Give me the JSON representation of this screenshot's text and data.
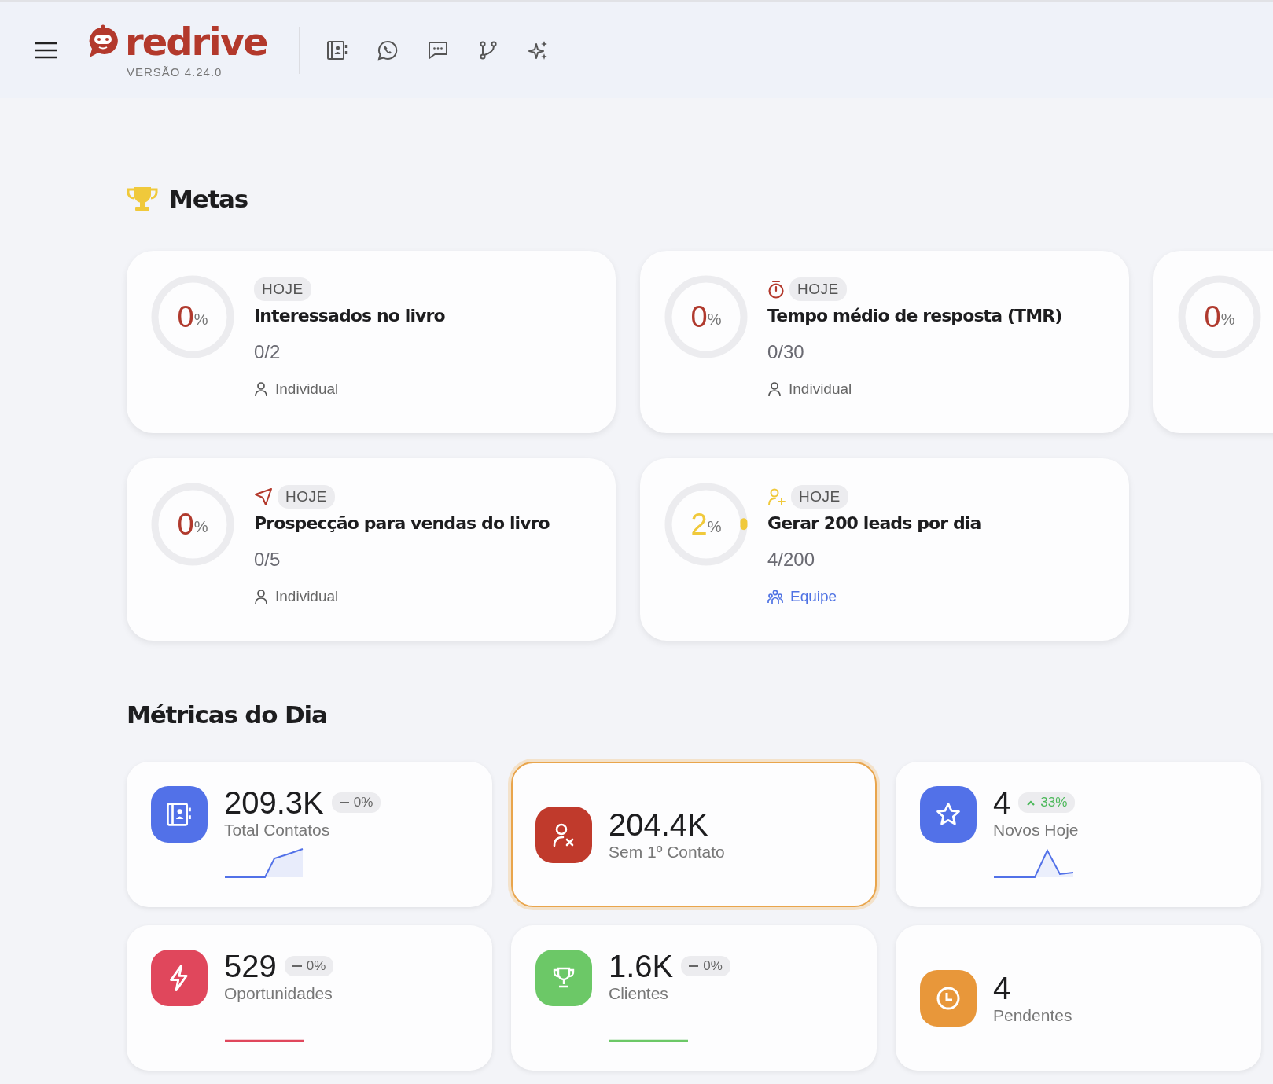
{
  "header": {
    "brand": "redrive",
    "version": "VERSÃO 4.24.0",
    "toolbar": [
      {
        "kind": "contacts"
      },
      {
        "kind": "whatsapp"
      },
      {
        "kind": "chat"
      },
      {
        "kind": "branch"
      },
      {
        "kind": "sparkle"
      }
    ]
  },
  "goals": {
    "title": "Metas",
    "items": [
      {
        "percent": "0",
        "unit": "%",
        "level": 0,
        "color": "#b03a2e",
        "badge": "HOJE",
        "title": "Interessados no livro",
        "progress": "0/2",
        "scope": {
          "kind": "individual",
          "label": "Individual"
        }
      },
      {
        "percent": "0",
        "unit": "%",
        "level": 0,
        "color": "#b03a2e",
        "kind": "timer",
        "badge": "HOJE",
        "title": "Tempo médio de resposta (TMR)",
        "progress": "0/30",
        "scope": {
          "kind": "individual",
          "label": "Individual"
        }
      },
      {
        "percent": "0",
        "unit": "%",
        "level": 0,
        "color": "#b03a2e"
      },
      {
        "percent": "0",
        "unit": "%",
        "level": 0,
        "color": "#b03a2e",
        "kind": "send",
        "badge": "HOJE",
        "title": "Prospecção para vendas do livro",
        "progress": "0/5",
        "scope": {
          "kind": "individual",
          "label": "Individual"
        }
      },
      {
        "percent": "2",
        "unit": "%",
        "level": 0.02,
        "color": "#f0c93b",
        "kind": "user-plus",
        "badge": "HOJE",
        "title": "Gerar 200 leads por dia",
        "progress": "4/200",
        "scope": {
          "kind": "team",
          "label": "Equipe"
        }
      }
    ]
  },
  "metrics": {
    "title": "Métricas do Dia",
    "items": [
      {
        "kind": "contacts",
        "color": "#5271e8",
        "value": "209.3K",
        "delta": {
          "kind": "flat",
          "text": "0%"
        },
        "label": "Total Contatos",
        "sparkline": {
          "kind": "rise"
        },
        "selected": false
      },
      {
        "kind": "user-x",
        "color": "#c03a2c",
        "value": "204.4K",
        "label": "Sem 1º Contato",
        "selected": true
      },
      {
        "kind": "star",
        "color": "#5271e8",
        "value": "4",
        "delta": {
          "kind": "up",
          "text": "33%"
        },
        "label": "Novos Hoje",
        "sparkline": {
          "kind": "spike"
        },
        "selected": false
      },
      {
        "kind": "bolt",
        "color": "#e0475c",
        "value": "529",
        "delta": {
          "kind": "flat",
          "text": "0%"
        },
        "label": "Oportunidades",
        "sparkline": {
          "kind": "flat"
        },
        "selected": false
      },
      {
        "kind": "trophy",
        "color": "#6cc867",
        "value": "1.6K",
        "delta": {
          "kind": "flat",
          "text": "0%"
        },
        "label": "Clientes",
        "sparkline": {
          "kind": "flat"
        },
        "selected": false
      },
      {
        "kind": "clock",
        "color": "#e8973a",
        "value": "4",
        "label": "Pendentes",
        "selected": false
      }
    ]
  }
}
